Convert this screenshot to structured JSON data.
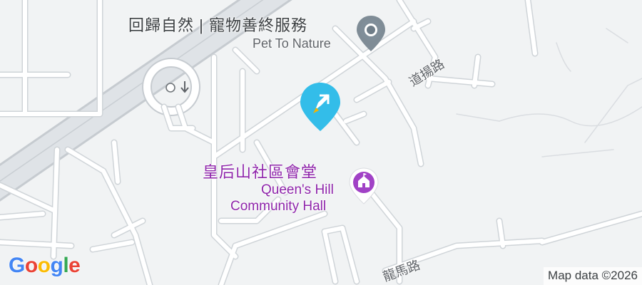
{
  "poi_pet": {
    "name_zh": "回歸自然 | 寵物善終服務",
    "name_en": "Pet To Nature",
    "icon": "service-pin-icon"
  },
  "poi_hall": {
    "name_zh": "皇后山社區會堂",
    "line1_en": "Queen's Hill",
    "line2_en": "Community Hall",
    "icon": "community-hall-pin-icon"
  },
  "roads": {
    "road_a": "道揚路",
    "road_b": "龍馬路"
  },
  "main_marker": {
    "icon": "map-marker-icon",
    "color": "#33bde9"
  },
  "logo": {
    "letters": [
      "G",
      "o",
      "o",
      "g",
      "l",
      "e"
    ],
    "colors": [
      "#4285f4",
      "#ea4335",
      "#fbbc05",
      "#4285f4",
      "#34a853",
      "#ea4335"
    ]
  },
  "attribution": "Map data ©2026"
}
